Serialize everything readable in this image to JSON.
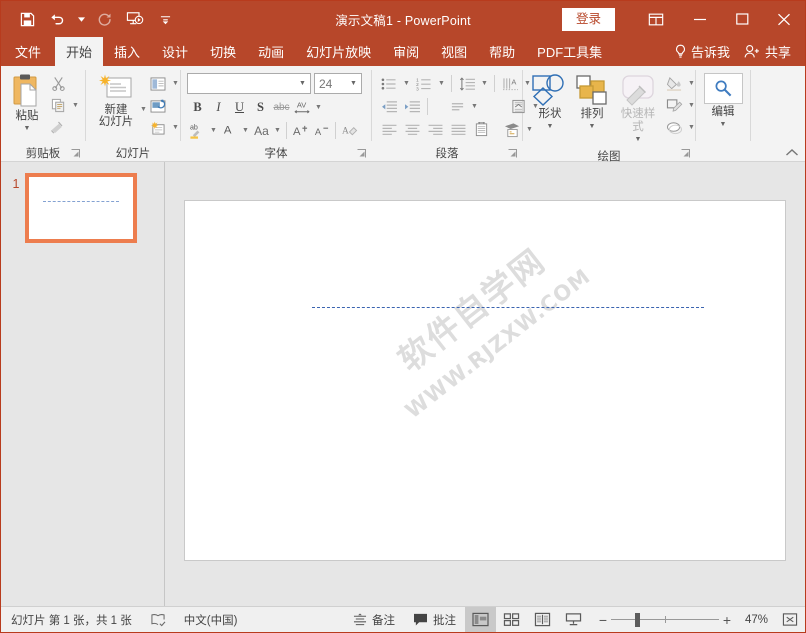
{
  "window": {
    "title": "演示文稿1  -  PowerPoint",
    "brand_color": "#b7472a",
    "accent_color": "#ed7d4e"
  },
  "quick_access": [
    {
      "name": "save-icon",
      "label": "保存"
    },
    {
      "name": "undo-icon",
      "label": "撤消"
    },
    {
      "name": "redo-icon",
      "label": "恢复"
    },
    {
      "name": "start-slideshow-icon",
      "label": "从头开始"
    },
    {
      "name": "customize-qat-icon",
      "label": "自定义快速访问工具栏"
    }
  ],
  "titlebar": {
    "signin_label": "登录",
    "ribbon_display_options": "功能区显示选项",
    "minimize": "最小化",
    "maximize": "最大化",
    "close": "关闭"
  },
  "tabs": [
    {
      "label": "文件",
      "active": false
    },
    {
      "label": "开始",
      "active": true
    },
    {
      "label": "插入",
      "active": false
    },
    {
      "label": "设计",
      "active": false
    },
    {
      "label": "切换",
      "active": false
    },
    {
      "label": "动画",
      "active": false
    },
    {
      "label": "幻灯片放映",
      "active": false
    },
    {
      "label": "审阅",
      "active": false
    },
    {
      "label": "视图",
      "active": false
    },
    {
      "label": "帮助",
      "active": false
    },
    {
      "label": "PDF工具集",
      "active": false
    }
  ],
  "tab_right": {
    "tell_me": "告诉我",
    "share": "共享"
  },
  "ribbon": {
    "clipboard": {
      "group_label": "剪贴板",
      "paste_label": "粘贴",
      "cut_label": "剪切",
      "copy_label": "复制",
      "format_painter_label": "格式刷"
    },
    "slides": {
      "group_label": "幻灯片",
      "new_slide_label": "新建\n幻灯片",
      "new_slide_line1": "新建",
      "new_slide_line2": "幻灯片",
      "layout_label": "版式",
      "reset_label": "重置",
      "section_label": "节"
    },
    "font": {
      "group_label": "字体",
      "font_name_value": "",
      "font_name_placeholder": "",
      "font_size_value": "24",
      "bold": "B",
      "italic": "I",
      "underline": "U",
      "shadow": "S",
      "strikethrough": "abc",
      "char_spacing": "AV",
      "text_highlight": "ab",
      "font_color": "A",
      "change_case": "Aa",
      "grow_font": "A",
      "shrink_font": "A",
      "clear_formatting": "清除所有格式"
    },
    "paragraph": {
      "group_label": "段落",
      "bullets": "项目符号",
      "numbering": "编号",
      "decrease_indent": "减少缩进量",
      "increase_indent": "增加缩进量",
      "line_spacing": "行距",
      "text_direction": "文字方向",
      "align_text": "对齐文本",
      "align_left": "左对齐",
      "align_center": "居中",
      "align_right": "右对齐",
      "justify": "两端对齐",
      "columns": "分栏",
      "convert_smartart": "转换为 SmartArt"
    },
    "drawing": {
      "group_label": "绘图",
      "shapes_label": "形状",
      "arrange_label": "排列",
      "quick_styles_label": "快速样式",
      "shape_fill": "形状填充",
      "shape_outline": "形状轮廓",
      "shape_effects": "形状效果"
    },
    "editing": {
      "group_label": "",
      "edit_label": "编辑"
    },
    "collapse_ribbon": "折叠功能区"
  },
  "slides_panel": {
    "thumbnails": [
      {
        "number": "1",
        "selected": true
      }
    ]
  },
  "slide_canvas": {
    "watermark_line1": "软件自学网",
    "watermark_line2": "WWW.RJZXW.COM",
    "has_dashed_line": true
  },
  "statusbar": {
    "slide_count_text": "幻灯片 第 1 张，共 1 张",
    "spellcheck_label": "拼写检查",
    "language": "中文(中国)",
    "notes_label": "备注",
    "comments_label": "批注",
    "views": [
      {
        "name": "normal-view",
        "label": "普通视图",
        "active": true
      },
      {
        "name": "slide-sorter-view",
        "label": "幻灯片浏览",
        "active": false
      },
      {
        "name": "reading-view",
        "label": "阅读视图",
        "active": false
      },
      {
        "name": "slideshow-view",
        "label": "幻灯片放映",
        "active": false
      }
    ],
    "zoom_out": "−",
    "zoom_in": "+",
    "zoom_percent": "47%",
    "fit_label": "使幻灯片适应当前窗口"
  }
}
